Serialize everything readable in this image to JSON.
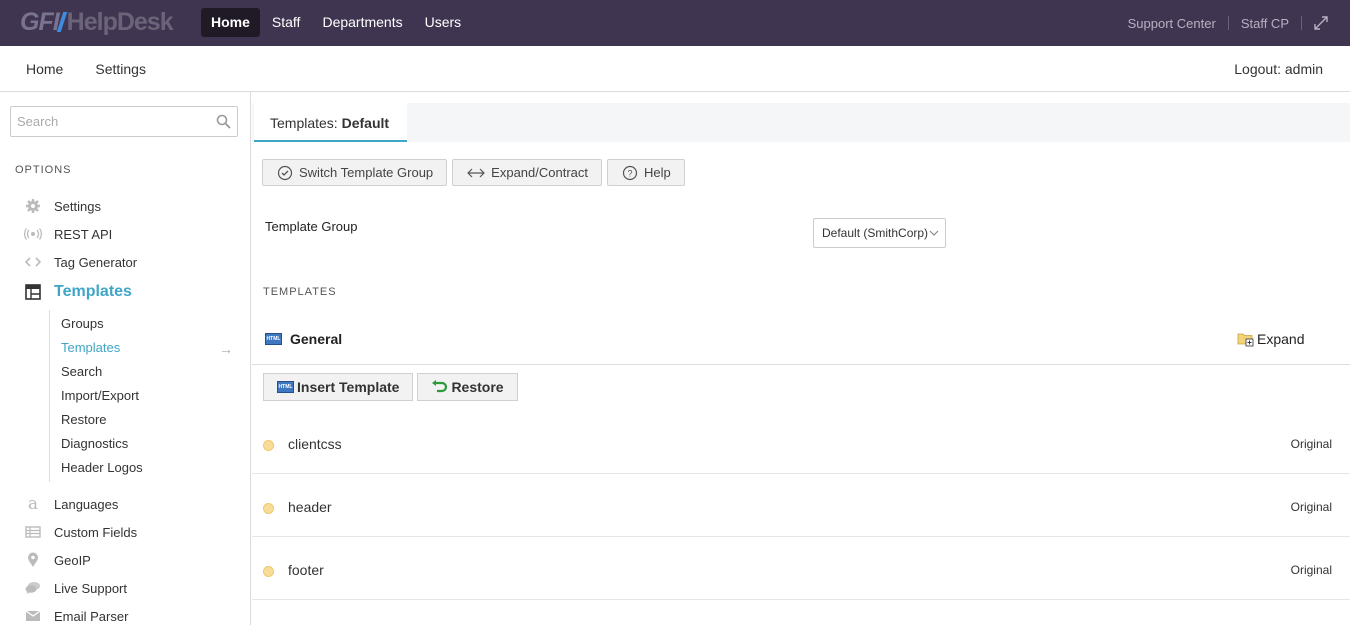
{
  "brand": {
    "logo_gfi": "GFI",
    "logo_text": "HelpDesk"
  },
  "topnav": [
    {
      "label": "Home",
      "active": true
    },
    {
      "label": "Staff",
      "active": false
    },
    {
      "label": "Departments",
      "active": false
    },
    {
      "label": "Users",
      "active": false
    }
  ],
  "toplinks": {
    "support_center": "Support Center",
    "staff_cp": "Staff CP"
  },
  "secnav": {
    "home": "Home",
    "settings": "Settings",
    "logout": "Logout: admin"
  },
  "sidebar": {
    "search_placeholder": "Search",
    "options_heading": "OPTIONS",
    "items": [
      {
        "label": "Settings",
        "icon": "gear-icon"
      },
      {
        "label": "REST API",
        "icon": "broadcast-icon"
      },
      {
        "label": "Tag Generator",
        "icon": "code-icon"
      },
      {
        "label": "Templates",
        "icon": "layout-icon",
        "active": true
      },
      {
        "label": "Languages",
        "icon": "letter-a-icon"
      },
      {
        "label": "Custom Fields",
        "icon": "list-icon"
      },
      {
        "label": "GeoIP",
        "icon": "map-pin-icon"
      },
      {
        "label": "Live Support",
        "icon": "chat-icon"
      },
      {
        "label": "Email Parser",
        "icon": "envelope-icon"
      }
    ],
    "sub_items": [
      {
        "label": "Groups"
      },
      {
        "label": "Templates",
        "active": true
      },
      {
        "label": "Search"
      },
      {
        "label": "Import/Export"
      },
      {
        "label": "Restore"
      },
      {
        "label": "Diagnostics"
      },
      {
        "label": "Header Logos"
      }
    ],
    "arrow": "→"
  },
  "main": {
    "tab_prefix": "Templates: ",
    "tab_name": "Default",
    "buttons": {
      "switch": "Switch Template Group",
      "expand": "Expand/Contract",
      "help": "Help"
    },
    "template_group_label": "Template Group",
    "template_group_value": "Default (SmithCorp)",
    "templates_heading": "TEMPLATES",
    "section_title": "General",
    "expand_label": "Expand",
    "insert_label": "Insert Template",
    "restore_label": "Restore",
    "html_icon_text": "HTML",
    "rows": [
      {
        "name": "clientcss",
        "status": "Original"
      },
      {
        "name": "header",
        "status": "Original"
      },
      {
        "name": "footer",
        "status": "Original"
      }
    ]
  },
  "colors": {
    "topbar": "#3f3550",
    "accent": "#3fa6c6",
    "dot": "#f9dc98"
  }
}
